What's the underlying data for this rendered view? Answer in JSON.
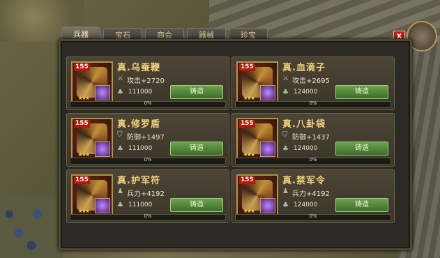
{
  "tabs": [
    "兵器",
    "宝石",
    "商会",
    "器械",
    "珍宝"
  ],
  "active_tab": 0,
  "close_label": "X",
  "cards": [
    {
      "level": "155",
      "name": "真.乌蚕鞭",
      "stat": "攻击+2720",
      "cost": "111000",
      "forge": "铸造",
      "progress_label": "0%",
      "progress": 0
    },
    {
      "level": "155",
      "name": "真.血滴子",
      "stat": "攻击+2695",
      "cost": "124000",
      "forge": "铸造",
      "progress_label": "0%",
      "progress": 0
    },
    {
      "level": "155",
      "name": "真.修罗盾",
      "stat": "防御+1497",
      "cost": "111000",
      "forge": "铸造",
      "progress_label": "0%",
      "progress": 0
    },
    {
      "level": "155",
      "name": "真.八卦袋",
      "stat": "防御+1437",
      "cost": "124000",
      "forge": "铸造",
      "progress_label": "0%",
      "progress": 0
    },
    {
      "level": "155",
      "name": "真.护军符",
      "stat": "兵力+4192",
      "cost": "111000",
      "forge": "铸造",
      "progress_label": "0%",
      "progress": 0
    },
    {
      "level": "155",
      "name": "真.禁军令",
      "stat": "兵力+4192",
      "cost": "124000",
      "forge": "铸造",
      "progress_label": "0%",
      "progress": 0
    }
  ]
}
